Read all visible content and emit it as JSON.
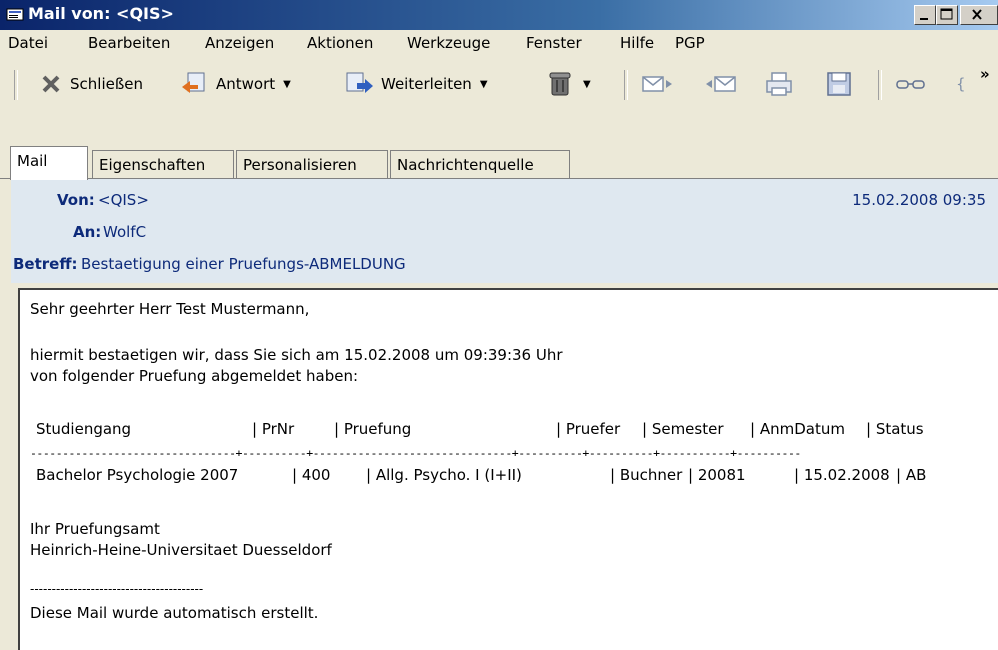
{
  "window": {
    "title": "Mail von: <QIS>"
  },
  "menu": [
    "Datei",
    "Bearbeiten",
    "Anzeigen",
    "Aktionen",
    "Werkzeuge",
    "Fenster",
    "Hilfe",
    "PGP"
  ],
  "toolbar": {
    "close_label": "Schließen",
    "reply_label": "Antwort",
    "forward_label": "Weiterleiten",
    "overflow": "»"
  },
  "tabs": [
    "Mail",
    "Eigenschaften",
    "Personalisieren",
    "Nachrichtenquelle"
  ],
  "header": {
    "from_label": "Von:",
    "from_value": "<QIS>",
    "to_label": "An:",
    "to_value": "WolfC",
    "subject_label": "Betreff:",
    "subject_value": "Bestaetigung einer Pruefungs-ABMELDUNG",
    "date": "15.02.2008 09:35"
  },
  "body": {
    "greeting": "Sehr geehrter Herr Test Mustermann,",
    "line1": "hiermit bestaetigen wir, dass Sie sich am 15.02.2008 um 09:39:36 Uhr",
    "line2": "von folgender Pruefung abgemeldet haben:",
    "table_headers": [
      "Studiengang",
      "| PrNr",
      "| Pruefung",
      "| Pruefer",
      "| Semester",
      "| AnmDatum",
      "| Status"
    ],
    "table_divider": "--------------------------------+----------+-------------------------------+----------+----------+-----------+----------",
    "table_row": [
      "Bachelor Psychologie 2007",
      "| 400",
      "| Allg. Psycho. I (I+II)",
      "| Buchner",
      "| 20081",
      "| 15.02.2008",
      "| AB"
    ],
    "sign1": "Ihr Pruefungsamt",
    "sign2": "Heinrich-Heine-Universitaet Duesseldorf",
    "rule": "----------------------------------------",
    "footer": "Diese Mail wurde automatisch erstellt."
  }
}
